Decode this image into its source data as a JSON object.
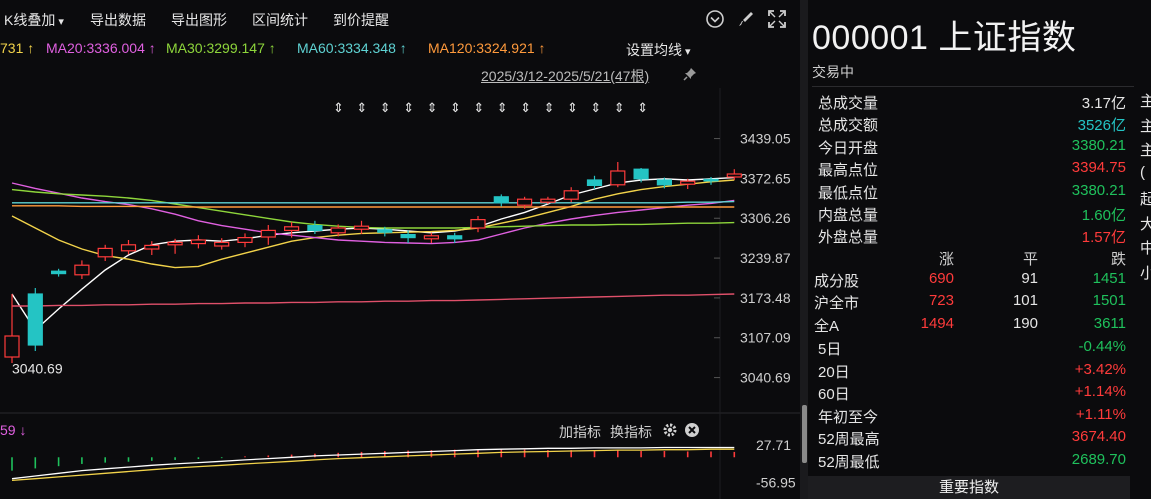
{
  "toolbar": {
    "kline_overlay": "K线叠加",
    "export_data": "导出数据",
    "export_chart": "导出图形",
    "range_stats": "区间统计",
    "price_alert": "到价提醒"
  },
  "ma_bar": {
    "ma10": "731 ↑",
    "ma20": "MA20:3336.004 ↑",
    "ma30": "MA30:3299.147 ↑",
    "ma60": "MA60:3334.348 ↑",
    "ma120": "MA120:3324.921 ↑",
    "settings": "设置均线"
  },
  "date_range": "2025/3/12-2025/5/21(47根)",
  "axis": {
    "ticks": [
      "3439.05",
      "3372.65",
      "3306.26",
      "3239.87",
      "3173.48",
      "3107.09",
      "3040.69"
    ],
    "low_label": "3040.69"
  },
  "indicator": {
    "left_value": "59 ↓",
    "add": "加指标",
    "switch": "换指标",
    "ticks": [
      "27.71",
      "-56.95"
    ]
  },
  "chart_data": {
    "type": "candlestick",
    "ylim": [
      3015,
      3460
    ],
    "candles": [
      [
        3075,
        3180,
        3110,
        3065
      ],
      [
        3180,
        3190,
        3095,
        3085
      ],
      [
        3218,
        3222,
        3214,
        3209
      ],
      [
        3212,
        3236,
        3228,
        3205
      ],
      [
        3242,
        3262,
        3256,
        3235
      ],
      [
        3252,
        3270,
        3262,
        3246
      ],
      [
        3255,
        3268,
        3261,
        3245
      ],
      [
        3262,
        3272,
        3266,
        3247
      ],
      [
        3264,
        3278,
        3270,
        3256
      ],
      [
        3260,
        3273,
        3266,
        3254
      ],
      [
        3266,
        3281,
        3274,
        3258
      ],
      [
        3275,
        3295,
        3286,
        3262
      ],
      [
        3286,
        3300,
        3292,
        3274
      ],
      [
        3294,
        3302,
        3286,
        3280
      ],
      [
        3282,
        3296,
        3290,
        3276
      ],
      [
        3288,
        3302,
        3293,
        3280
      ],
      [
        3287,
        3292,
        3283,
        3276
      ],
      [
        3279,
        3286,
        3274,
        3265
      ],
      [
        3272,
        3282,
        3277,
        3265
      ],
      [
        3277,
        3282,
        3272,
        3265
      ],
      [
        3290,
        3310,
        3304,
        3283
      ],
      [
        3342,
        3346,
        3332,
        3326
      ],
      [
        3328,
        3342,
        3338,
        3322
      ],
      [
        3333,
        3342,
        3338,
        3330
      ],
      [
        3338,
        3358,
        3352,
        3333
      ],
      [
        3370,
        3377,
        3361,
        3355
      ],
      [
        3362,
        3400,
        3385,
        3358
      ],
      [
        3388,
        3390,
        3372,
        3366
      ],
      [
        3370,
        3374,
        3362,
        3356
      ],
      [
        3363,
        3372,
        3368,
        3355
      ],
      [
        3371,
        3375,
        3369,
        3362
      ],
      [
        3375,
        3388,
        3380,
        3370
      ]
    ],
    "series": [
      {
        "name": "MA10",
        "color": "#ffffff",
        "values": [
          3180,
          3120,
          3155,
          3188,
          3220,
          3245,
          3262,
          3268,
          3270,
          3268,
          3272,
          3278,
          3282,
          3285,
          3288,
          3290,
          3288,
          3285,
          3282,
          3285,
          3292,
          3305,
          3316,
          3330,
          3345,
          3355,
          3365,
          3370,
          3372,
          3370,
          3372,
          3374
        ]
      },
      {
        "name": "MA20",
        "color": "#f2d34a",
        "values": [
          3310,
          3290,
          3270,
          3255,
          3244,
          3238,
          3230,
          3224,
          3226,
          3238,
          3248,
          3258,
          3268,
          3274,
          3278,
          3281,
          3282,
          3283,
          3284,
          3286,
          3290,
          3298,
          3306,
          3316,
          3326,
          3338,
          3347,
          3354,
          3359,
          3363,
          3367,
          3370
        ]
      },
      {
        "name": "MA30",
        "color": "#e060e0",
        "values": [
          3365,
          3356,
          3348,
          3340,
          3334,
          3329,
          3322,
          3313,
          3302,
          3294,
          3288,
          3282,
          3278,
          3274,
          3270,
          3268,
          3266,
          3265,
          3264,
          3266,
          3270,
          3280,
          3290,
          3298,
          3305,
          3311,
          3316,
          3320,
          3324,
          3328,
          3331,
          3336
        ]
      },
      {
        "name": "MA60",
        "color": "#8ed63b",
        "values": [
          3354,
          3350,
          3347,
          3345,
          3343,
          3340,
          3336,
          3330,
          3324,
          3318,
          3312,
          3306,
          3300,
          3296,
          3293,
          3291,
          3290,
          3290,
          3290,
          3290,
          3291,
          3292,
          3293,
          3294,
          3295,
          3295,
          3296,
          3296,
          3297,
          3298,
          3298,
          3299
        ]
      },
      {
        "name": "MA120",
        "color": "#ff9a3c",
        "values": [
          3327,
          3327,
          3327,
          3326,
          3326,
          3326,
          3326,
          3325,
          3325,
          3325,
          3325,
          3325,
          3325,
          3325,
          3325,
          3325,
          3325,
          3325,
          3325,
          3325,
          3325,
          3325,
          3325,
          3325,
          3325,
          3325,
          3325,
          3325,
          3325,
          3325,
          3325,
          3325
        ]
      },
      {
        "name": "MA250",
        "color": "#5fd3d3",
        "values": [
          3332,
          3332,
          3332,
          3332,
          3332,
          3332,
          3332,
          3332,
          3332,
          3332,
          3332,
          3332,
          3332,
          3332,
          3332,
          3332,
          3332,
          3332,
          3332,
          3332,
          3332,
          3332,
          3332,
          3332,
          3332,
          3332,
          3332,
          3332,
          3332,
          3333,
          3333,
          3334
        ]
      },
      {
        "name": "MA500",
        "color": "#e0506a",
        "values": [
          3160,
          3160,
          3161,
          3161,
          3162,
          3162,
          3163,
          3163,
          3164,
          3164,
          3165,
          3165,
          3166,
          3166,
          3167,
          3167,
          3168,
          3168,
          3169,
          3169,
          3170,
          3171,
          3172,
          3173,
          3174,
          3175,
          3176,
          3177,
          3178,
          3178,
          3179,
          3180
        ]
      }
    ],
    "macd_ylim": [
      -60,
      32
    ],
    "macd_bars": [
      -30,
      -25,
      -20,
      -15,
      -12,
      -10,
      -8,
      -6,
      -4,
      -2,
      2,
      4,
      6,
      8,
      10,
      12,
      14,
      15,
      16,
      17,
      18,
      18,
      17,
      16,
      16,
      15,
      15,
      14,
      14,
      13,
      13,
      12
    ],
    "macd_dif": [
      -48,
      -42,
      -36,
      -30,
      -26,
      -22,
      -18,
      -15,
      -12,
      -9,
      -6,
      -3,
      0,
      3,
      5,
      7,
      9,
      11,
      13,
      15,
      17,
      18,
      19,
      20,
      20,
      21,
      21,
      21,
      22,
      22,
      22,
      22
    ],
    "macd_dea": [
      -52,
      -48,
      -44,
      -40,
      -36,
      -32,
      -28,
      -24,
      -21,
      -18,
      -15,
      -12,
      -9,
      -6,
      -3,
      -1,
      1,
      3,
      5,
      7,
      9,
      11,
      12,
      13,
      14,
      15,
      16,
      16,
      17,
      17,
      18,
      18
    ]
  },
  "panel": {
    "code_name": "000001 上证指数",
    "status": "交易中",
    "stats": [
      {
        "label": "总成交量",
        "value": "3.17亿",
        "color": "white"
      },
      {
        "label": "总成交额",
        "value": "3526亿",
        "color": "teal"
      },
      {
        "label": "今日开盘",
        "value": "3380.21",
        "color": "green"
      },
      {
        "label": "最高点位",
        "value": "3394.75",
        "color": "red"
      },
      {
        "label": "最低点位",
        "value": "3380.21",
        "color": "green"
      },
      {
        "label": "内盘总量",
        "value": "1.60亿",
        "color": "green"
      },
      {
        "label": "外盘总量",
        "value": "1.57亿",
        "color": "red"
      }
    ],
    "breadth_header": [
      "涨",
      "平",
      "跌"
    ],
    "breadth": [
      {
        "label": "成分股",
        "up": "690",
        "flat": "91",
        "down": "1451"
      },
      {
        "label": "沪全市",
        "up": "723",
        "flat": "101",
        "down": "1501"
      },
      {
        "label": "全A",
        "up": "1494",
        "flat": "190",
        "down": "3611"
      }
    ],
    "periods": [
      {
        "label": "5日",
        "value": "-0.44%",
        "color": "green"
      },
      {
        "label": "20日",
        "value": "+3.42%",
        "color": "red"
      },
      {
        "label": "60日",
        "value": "+1.14%",
        "color": "red"
      },
      {
        "label": "年初至今",
        "value": "+1.11%",
        "color": "red"
      },
      {
        "label": "52周最高",
        "value": "3674.40",
        "color": "red"
      },
      {
        "label": "52周最低",
        "value": "2689.70",
        "color": "green"
      }
    ],
    "button": "重要指数"
  },
  "far_column": [
    "主",
    "主",
    "主",
    "(",
    "起",
    "大",
    "中",
    "小"
  ]
}
